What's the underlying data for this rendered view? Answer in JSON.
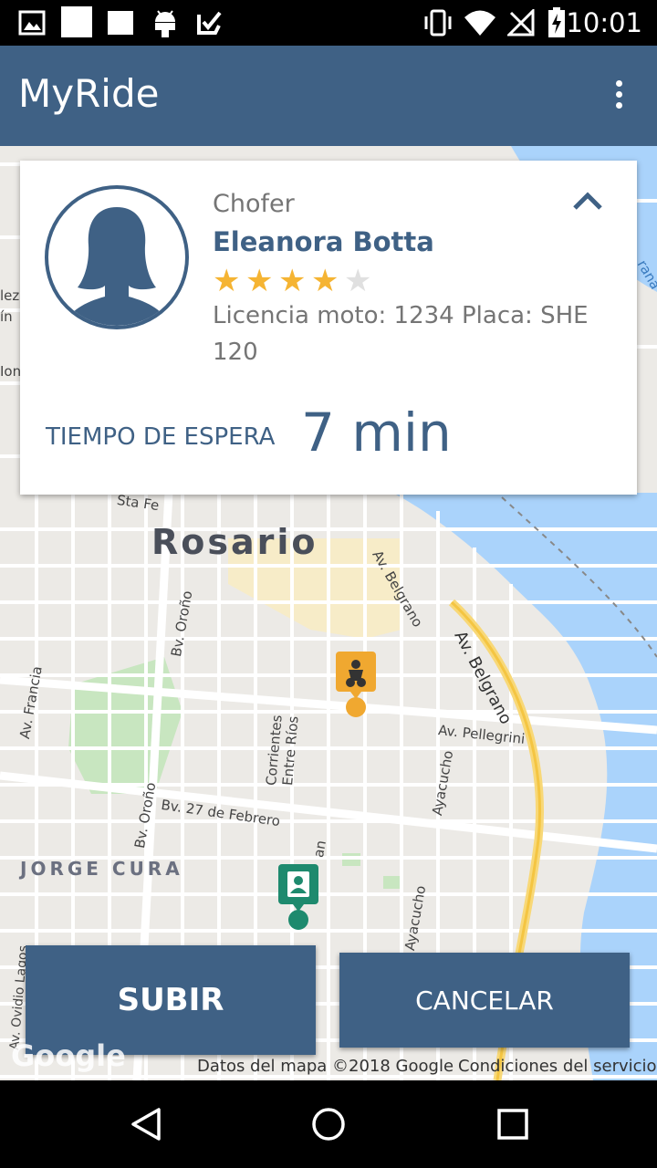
{
  "status_bar": {
    "time": "10:01",
    "left_icons": [
      "image-icon",
      "square-icon",
      "square-icon",
      "android-icon",
      "checkbox-icon"
    ],
    "right_icons": [
      "vibrate-icon",
      "wifi-icon",
      "no-signal-icon",
      "battery-charging-icon"
    ]
  },
  "app_bar": {
    "title": "MyRide",
    "menu_icon": "overflow-menu-icon"
  },
  "driver_card": {
    "role": "Chofer",
    "name": "Eleanora Botta",
    "rating": 4,
    "rating_max": 5,
    "license_text": "Licencia moto:    1234 Placa: SHE 120",
    "wait_label": "TIEMPO DE ESPERA",
    "wait_value": "7 min",
    "collapse_icon": "chevron-up-icon",
    "avatar_icon": "female-avatar-icon"
  },
  "map": {
    "city_label": "Rosario",
    "district_label": "JORGE CURA",
    "street_labels": {
      "sta_fe": "Sta Fe",
      "av_belgrano_top": "Av. Belgrano",
      "av_belgrano": "Av. Belgrano",
      "bv_orono_top": "Bv. Oroño",
      "bv_orono_bottom": "Bv. Oroño",
      "av_francia": "Av. Francia",
      "corrientes": "Corrientes",
      "entre_rios": "Entre Ríos",
      "av_pellegrini": "Av. Pellegrini",
      "ayacucho_top": "Ayacucho",
      "ayacucho_bottom": "Ayacucho",
      "bv_27_febrero": "Bv. 27 de Febrero",
      "av_ovidio_lagos": "Av. Ovidio Lagos",
      "edge_left_1": "lez",
      "edge_left_2": "ín",
      "edge_left_3": "Ion",
      "edge_right": "rana",
      "partial_street": "an"
    },
    "markers": [
      "motorcycle-marker-icon",
      "person-marker-icon"
    ],
    "credit": "Datos del mapa ©2018 Google",
    "terms": "Condiciones del servicio",
    "logo": "Google"
  },
  "actions": {
    "board_label": "SUBIR",
    "cancel_label": "CANCELAR"
  },
  "nav_bar": {
    "icons": [
      "back-icon",
      "home-icon",
      "recents-icon"
    ]
  },
  "colors": {
    "primary": "#3f6185",
    "star_filled": "#f5b433",
    "star_empty": "#e0e0e0",
    "water": "#aad3fb",
    "marker_moto": "#f0a830",
    "marker_person": "#1e8a6e"
  }
}
